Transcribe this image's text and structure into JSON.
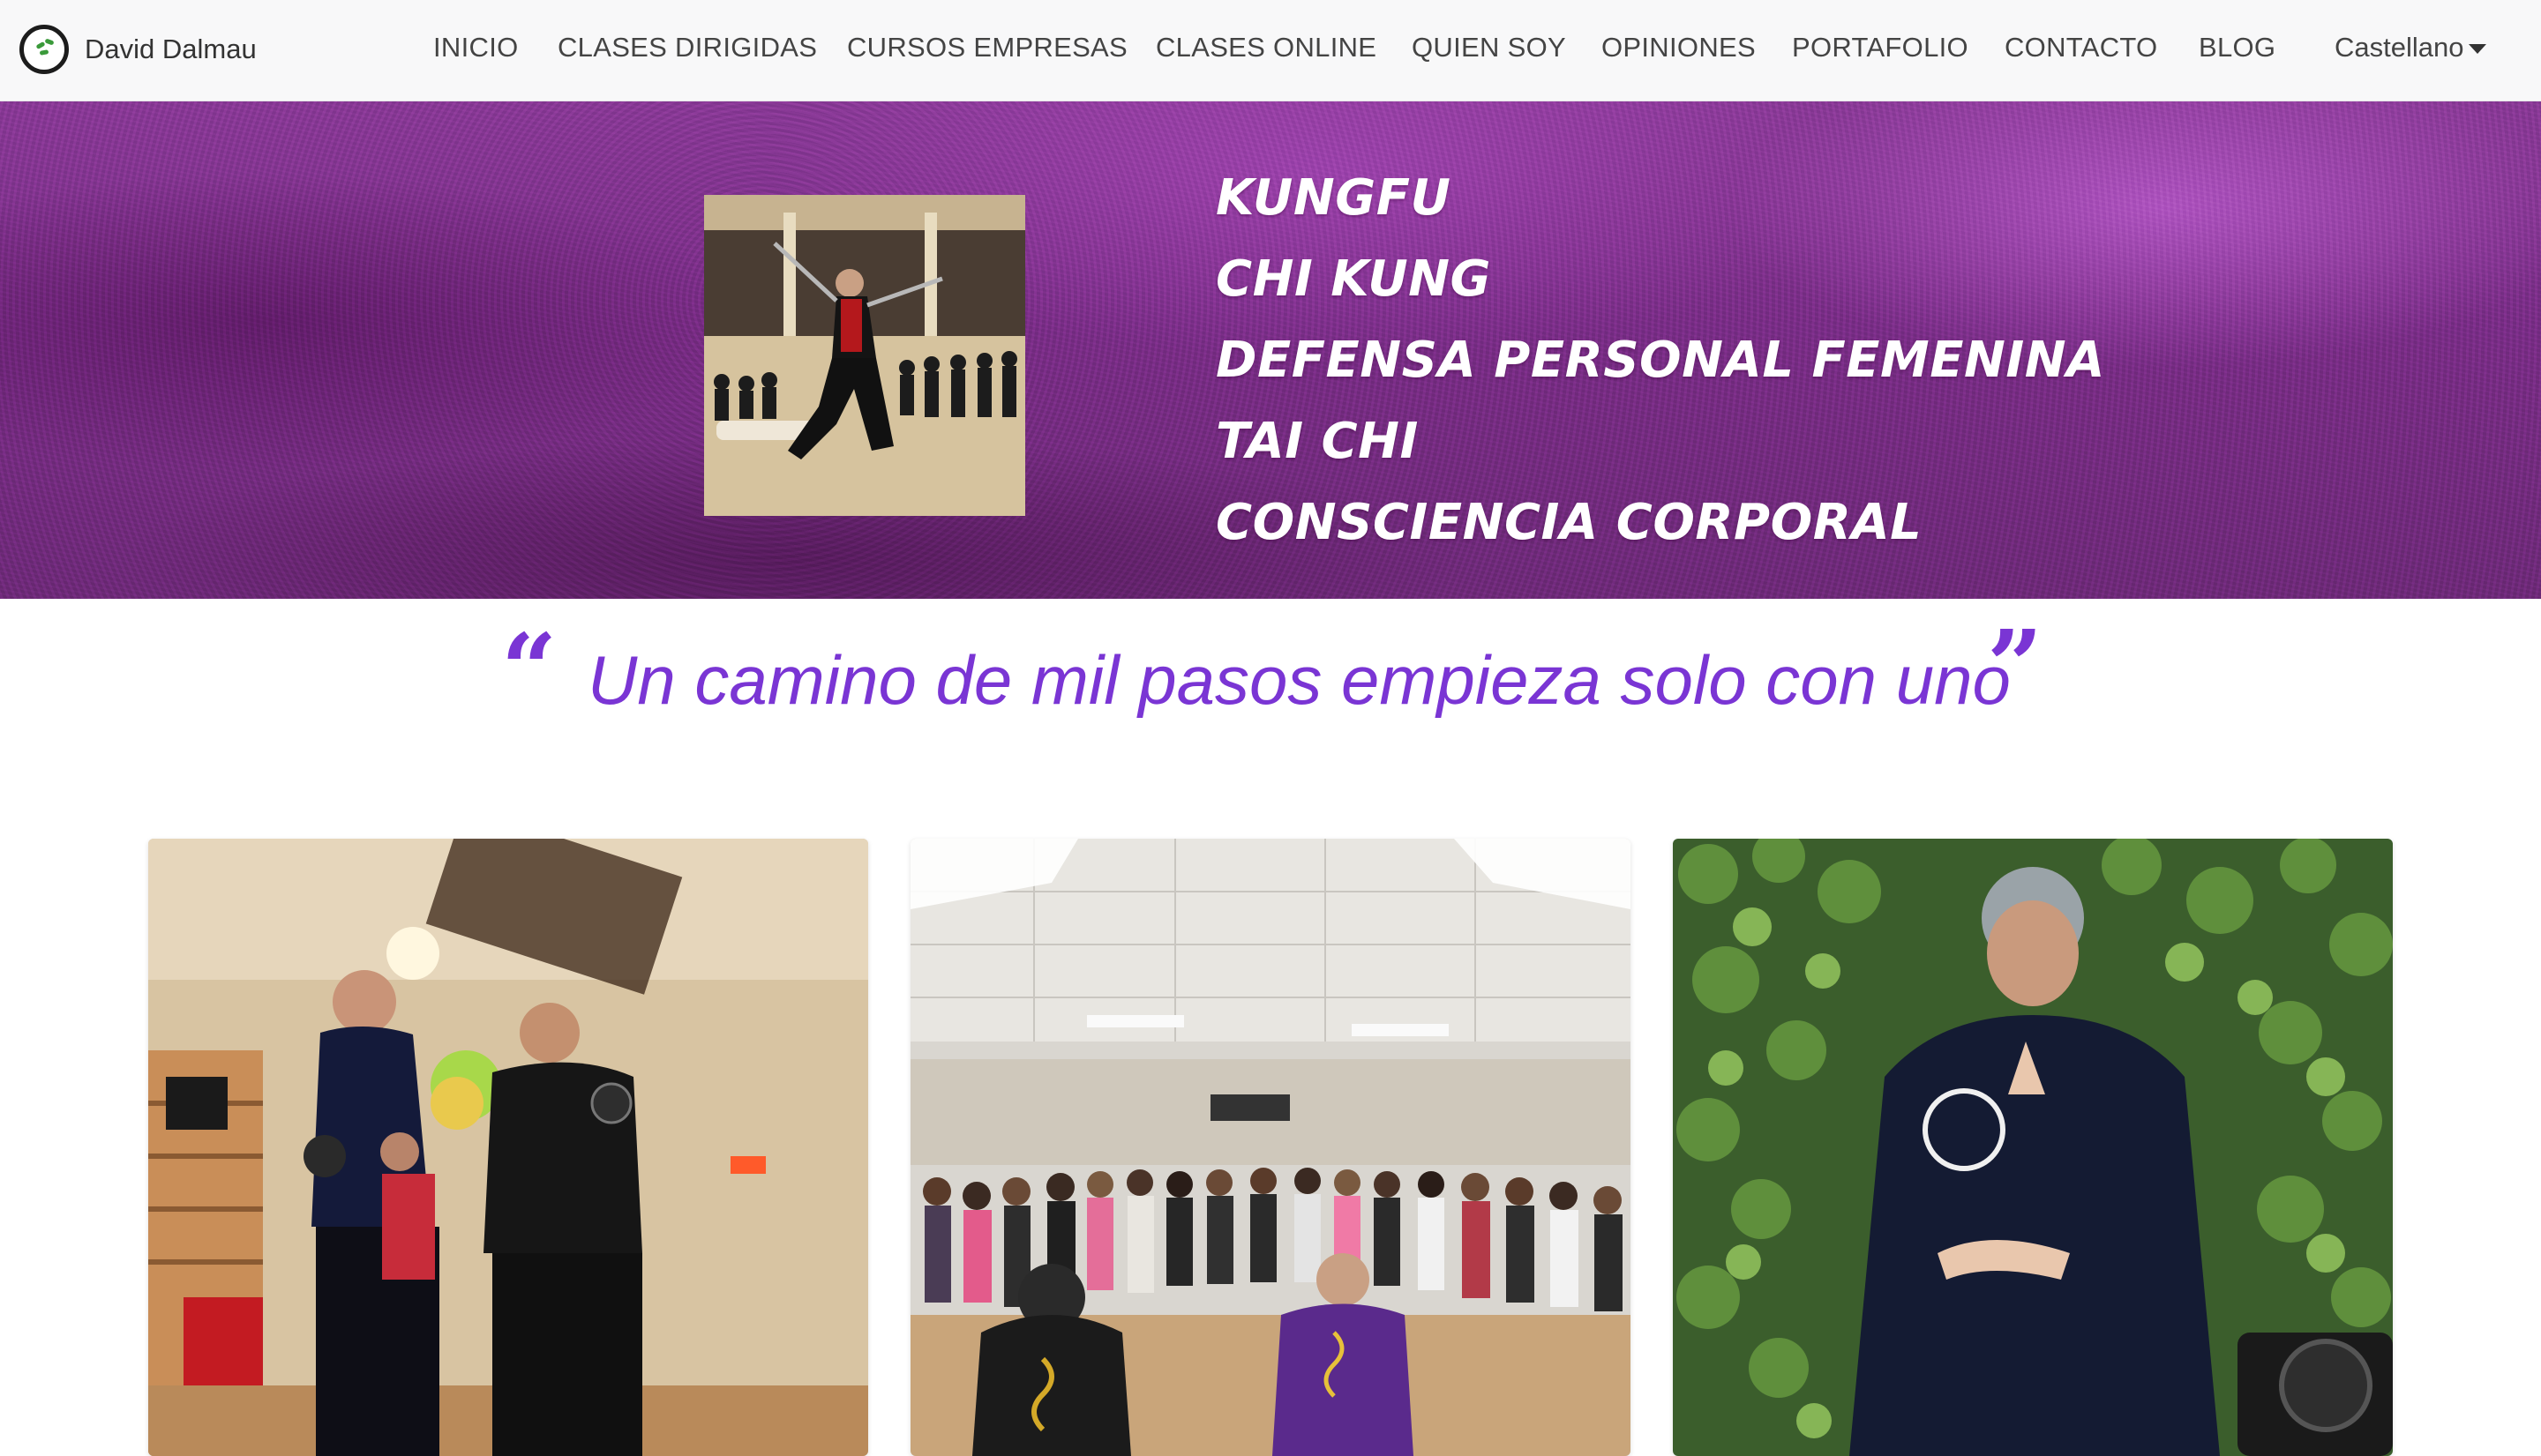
{
  "brand": {
    "name": "David Dalmau",
    "logo_icon": "enso-circle-icon"
  },
  "nav": {
    "items": [
      {
        "label": "INICIO"
      },
      {
        "label": "CLASES DIRIGIDAS"
      },
      {
        "label": "CURSOS EMPRESAS"
      },
      {
        "label": "CLASES ONLINE"
      },
      {
        "label": "QUIEN SOY"
      },
      {
        "label": "OPINIONES"
      },
      {
        "label": "PORTAFOLIO"
      },
      {
        "label": "CONTACTO"
      },
      {
        "label": "BLOG"
      }
    ],
    "language": "Castellano"
  },
  "hero": {
    "disciplines": [
      "KUNGFU",
      "CHI KUNG",
      "DEFENSA PERSONAL FEMENINA",
      "TAI CHI",
      "CONSCIENCIA CORPORAL"
    ],
    "accent_color": "#8a3a97"
  },
  "quote": {
    "open": "“",
    "text": "Un camino de mil pasos empieza solo con uno",
    "close": "”",
    "color": "#7a35d4"
  },
  "cards": [
    {
      "icon": "kungfu-class-photo"
    },
    {
      "icon": "group-class-photo"
    },
    {
      "icon": "tai-chi-photo"
    }
  ]
}
